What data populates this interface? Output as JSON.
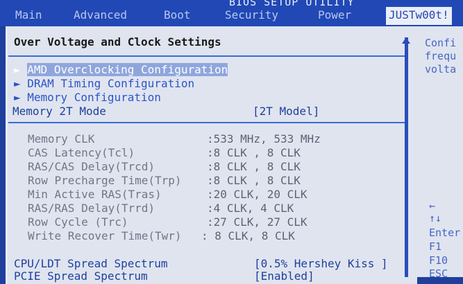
{
  "window": {
    "title": "BIOS SETUP UTILITY"
  },
  "menu": {
    "items": [
      {
        "label": "Main"
      },
      {
        "label": "Advanced"
      },
      {
        "label": "Boot"
      },
      {
        "label": "Security"
      },
      {
        "label": "Power"
      },
      {
        "label": "JUSTw00t!"
      }
    ]
  },
  "panel": {
    "title": "Over Voltage and Clock Settings",
    "submenus": [
      {
        "arrow": "►",
        "label": "AMD Overclocking Configuration"
      },
      {
        "arrow": "►",
        "label": "DRAM Timing Configuration"
      },
      {
        "arrow": "►",
        "label": "Memory Configuration"
      }
    ],
    "memory_2t": {
      "label": "Memory 2T Mode",
      "value": "[2T Model]"
    },
    "info_rows": [
      {
        "label": "Memory CLK",
        "value": ":533 MHz, 533 MHz"
      },
      {
        "label": "CAS Latency(Tcl)",
        "value": ":8 CLK , 8 CLK"
      },
      {
        "label": "RAS/CAS Delay(Trcd)",
        "value": ":8 CLK , 8 CLK"
      },
      {
        "label": "Row Precharge Time(Trp)",
        "value": ":8 CLK , 8 CLK"
      },
      {
        "label": "Min Active RAS(Tras)",
        "value": ":20 CLK, 20 CLK"
      },
      {
        "label": "RAS/RAS Delay(Trrd)",
        "value": ":4 CLK, 4 CLK"
      },
      {
        "label": "Row Cycle (Trc)",
        "value": ":27 CLK, 27 CLK"
      },
      {
        "label": "Write Recover Time(Twr)",
        "value": ": 8 CLK,  8 CLK"
      }
    ],
    "spread": [
      {
        "label": "CPU/LDT Spread Spectrum",
        "value": "[0.5% Hershey Kiss ]"
      },
      {
        "label": "PCIE Spread Spectrum",
        "value": "[Enabled]"
      }
    ]
  },
  "help": {
    "lines": [
      "Confi",
      "frequ",
      "volta"
    ],
    "keys": [
      "←",
      "↑↓",
      "Enter",
      "F1",
      "F10",
      "ESC"
    ]
  },
  "colors": {
    "background": "#1f3f9c",
    "panel": "#dfe4ef",
    "submenu": "#2d55c9",
    "highlight": "#8fa6dd"
  }
}
